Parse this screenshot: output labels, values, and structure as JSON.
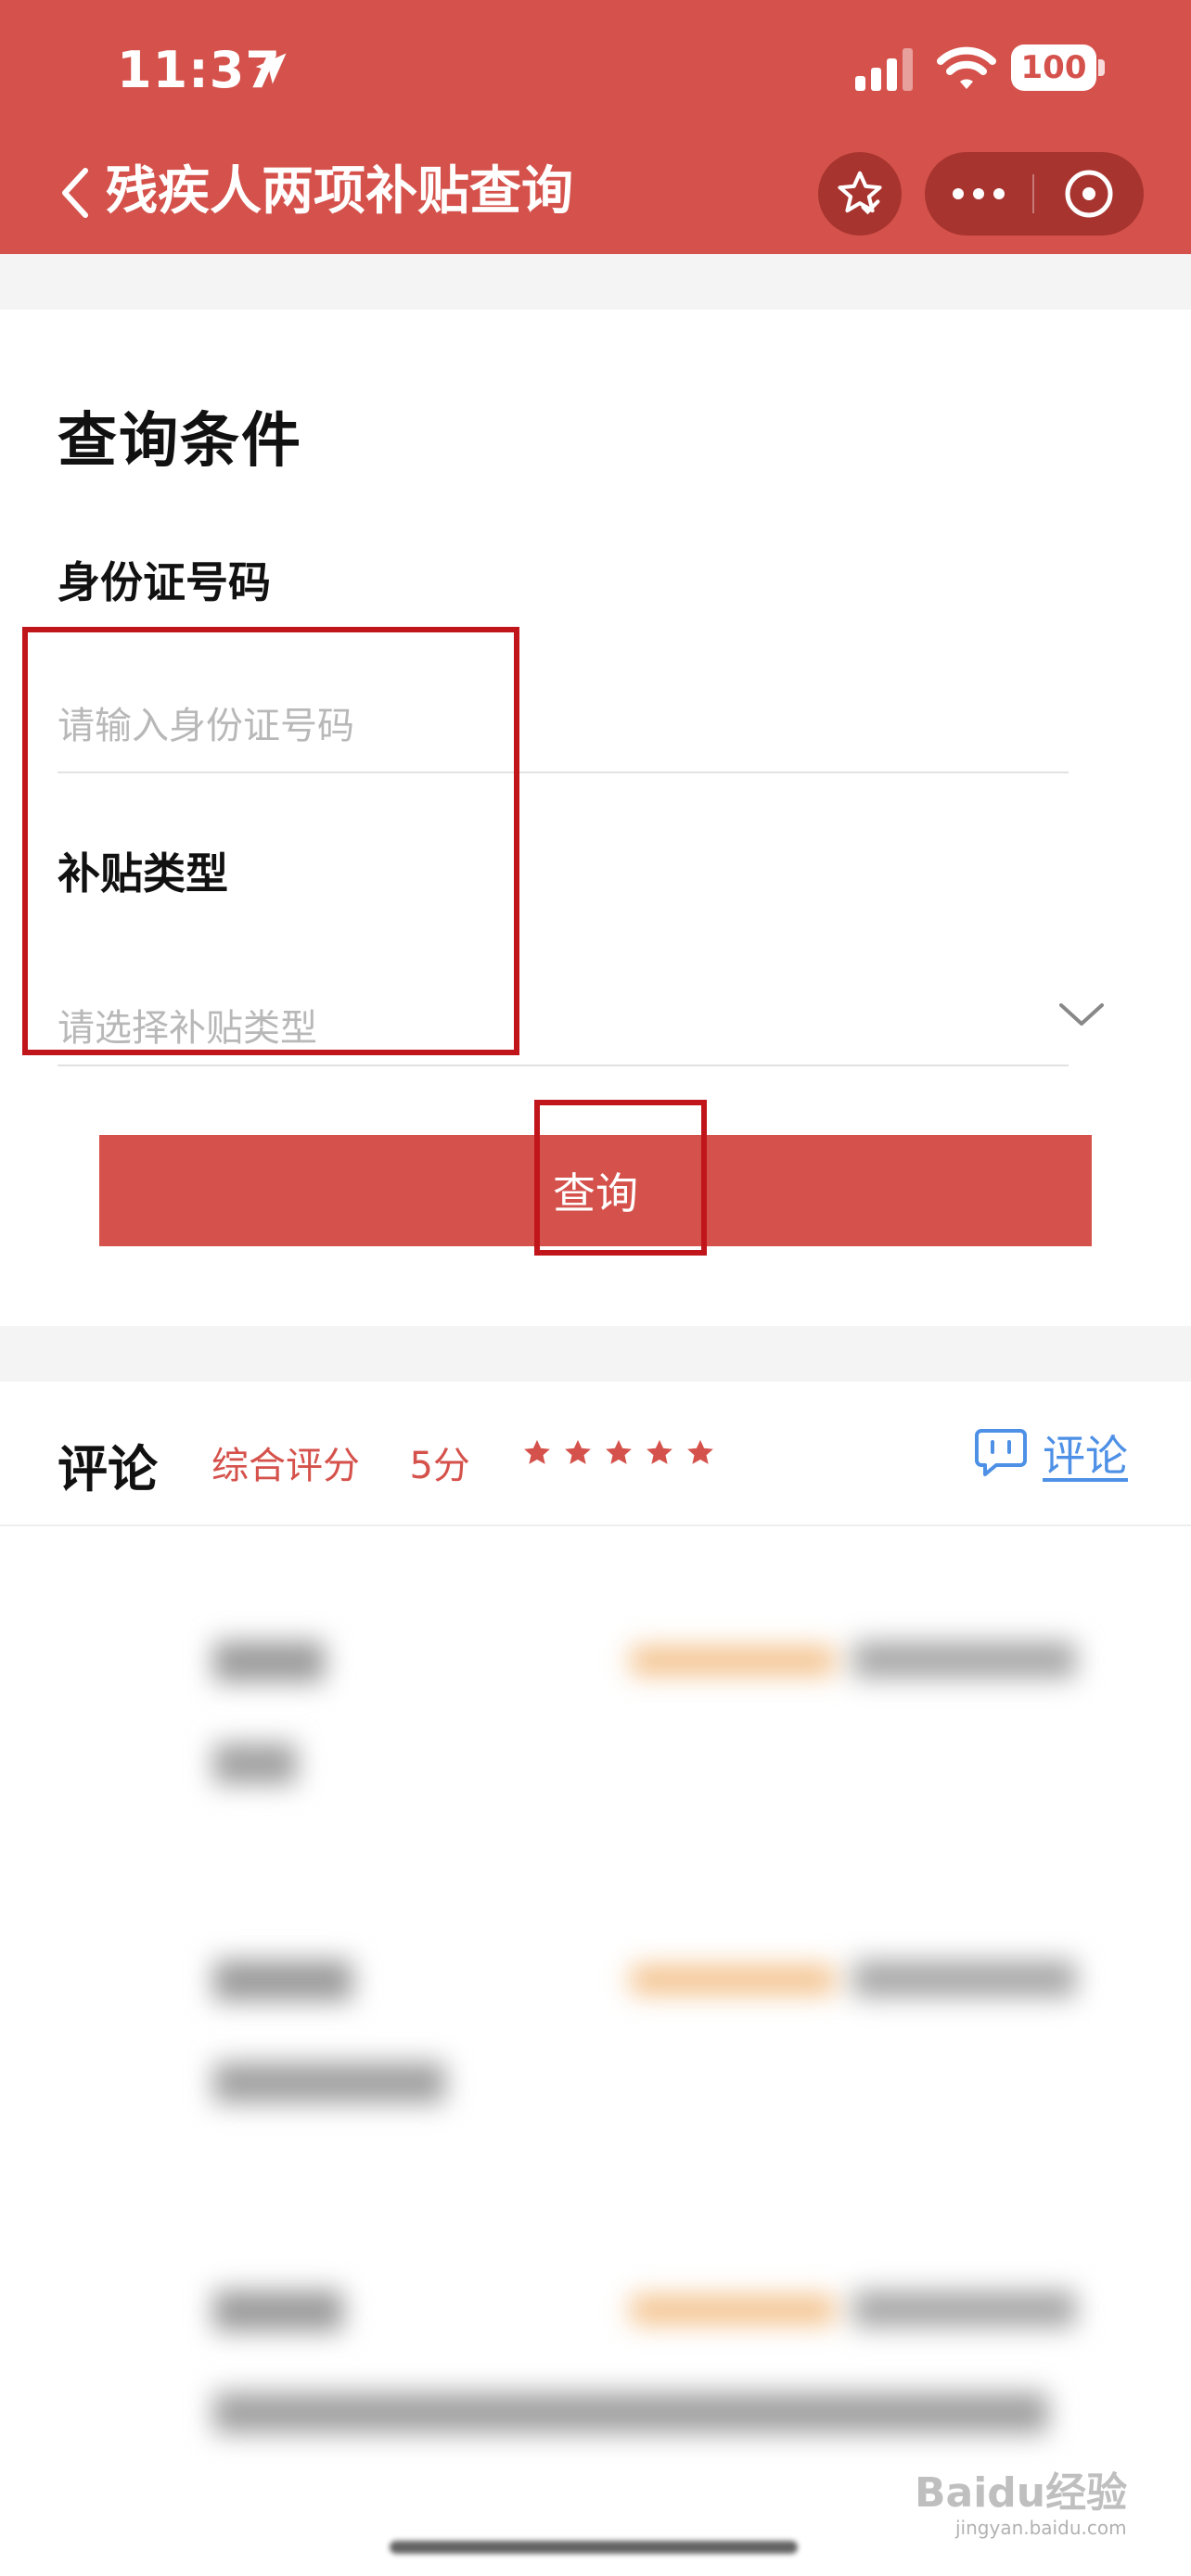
{
  "status_bar": {
    "time": "11:37",
    "battery": "100"
  },
  "nav": {
    "title": "残疾人两项补贴查询",
    "icons": [
      "back-chevron-icon",
      "star-favorite-icon",
      "more-dots-icon",
      "close-circle-icon"
    ]
  },
  "form": {
    "section_title": "查询条件",
    "id_label": "身份证号码",
    "id_placeholder": "请输入身份证号码",
    "id_value": "",
    "type_label": "补贴类型",
    "type_placeholder": "请选择补贴类型",
    "submit_label": "查询"
  },
  "comments": {
    "title": "评论",
    "score_text": "综合评分",
    "score_value": "5分",
    "stars": 5,
    "action_label": "评论",
    "items": [
      {
        "rating_color": "#f3c089"
      },
      {
        "rating_color": "#f3c089"
      },
      {
        "rating_color": "#f3c089"
      }
    ]
  },
  "watermark": {
    "text": "Baidu经验",
    "sub": "jingyan.baidu.com"
  },
  "colors": {
    "brand": "#d5524c",
    "brand_dark": "#a8342f",
    "highlight": "#c0151b",
    "link": "#4d90e6"
  }
}
